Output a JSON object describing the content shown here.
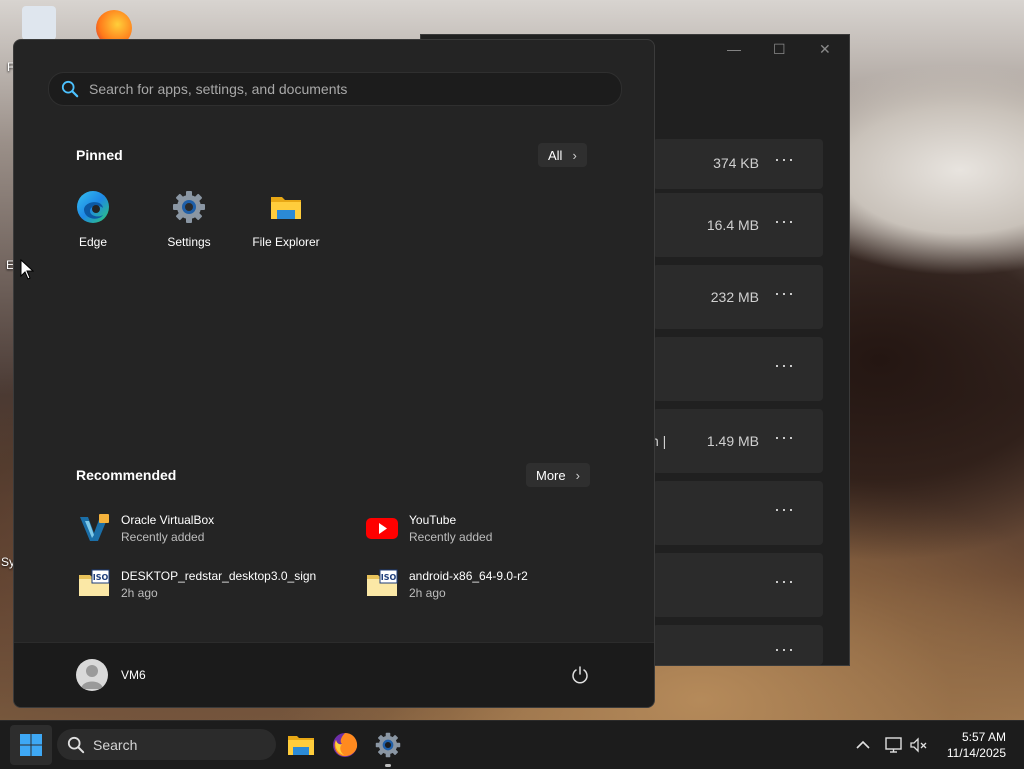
{
  "desktop": {
    "edge_partial_label": "E",
    "left_partial_1": "F",
    "left_partial_2": "Sy",
    "left_partial_3": "("
  },
  "background_window": {
    "rows": [
      {
        "size": "374 KB"
      },
      {
        "size": "16.4 MB"
      },
      {
        "size": "232 MB"
      },
      {
        "size": ""
      },
      {
        "size": "1.49 MB",
        "partial": "n   |"
      },
      {
        "size": ""
      },
      {
        "size": ""
      },
      {
        "size": ""
      }
    ],
    "more_glyph": "···",
    "controls": {
      "minimize": "—",
      "maximize": "☐",
      "close": "✕"
    }
  },
  "start_menu": {
    "search": {
      "placeholder": "Search for apps, settings, and documents"
    },
    "pinned": {
      "title": "Pinned",
      "all_label": "All",
      "apps": [
        {
          "label": "Edge",
          "icon": "edge-icon"
        },
        {
          "label": "Settings",
          "icon": "gear-icon"
        },
        {
          "label": "File Explorer",
          "icon": "folder-icon"
        }
      ]
    },
    "recommended": {
      "title": "Recommended",
      "more_label": "More",
      "items": [
        {
          "name": "Oracle VirtualBox",
          "sub": "Recently added",
          "icon": "virtualbox-icon"
        },
        {
          "name": "YouTube",
          "sub": "Recently added",
          "icon": "youtube-icon"
        },
        {
          "name": "DESKTOP_redstar_desktop3.0_sign",
          "sub": "2h ago",
          "icon": "iso-file-icon"
        },
        {
          "name": "android-x86_64-9.0-r2",
          "sub": "2h ago",
          "icon": "iso-file-icon"
        }
      ]
    },
    "user": {
      "name": "VM6"
    }
  },
  "taskbar": {
    "search_label": "Search",
    "clock": {
      "time": "5:57 AM",
      "date": "11/14/2025"
    }
  },
  "colors": {
    "accent": "#0078d4",
    "start_bg": "#242424",
    "taskbar_bg": "#1c1c1c"
  }
}
